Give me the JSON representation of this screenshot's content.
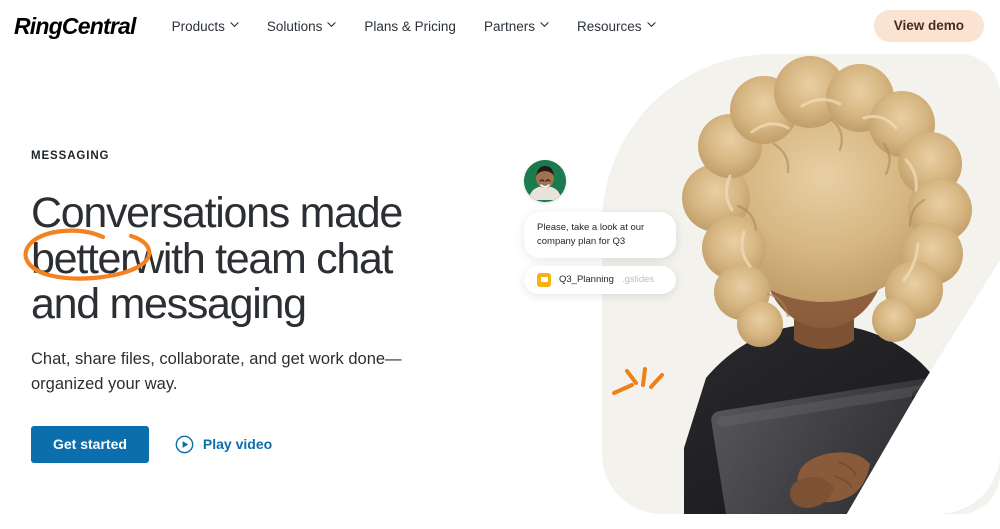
{
  "header": {
    "logo": {
      "part1": "Ring",
      "part2": "Central",
      "color1": "#0684bc",
      "color2": "#f68b1f"
    },
    "nav": [
      {
        "label": "Products",
        "has_dropdown": true,
        "icon": "chevron-down-icon"
      },
      {
        "label": "Solutions",
        "has_dropdown": true,
        "icon": "chevron-down-icon"
      },
      {
        "label": "Plans & Pricing",
        "has_dropdown": false
      },
      {
        "label": "Partners",
        "has_dropdown": true,
        "icon": "chevron-down-icon"
      },
      {
        "label": "Resources",
        "has_dropdown": true,
        "icon": "chevron-down-icon"
      }
    ],
    "cta": {
      "label": "View demo",
      "bg": "#fbe3d2",
      "color": "#4a2a1a"
    }
  },
  "hero": {
    "eyebrow": "MESSAGING",
    "headline": {
      "line1": "Conversations made",
      "line2_circled": "better",
      "line2_rest": "with team chat",
      "line3": "and messaging",
      "circle_color": "#f58220"
    },
    "subhead": {
      "line1": "Chat, share files, collaborate, and get work done—",
      "line2": "organized your way."
    },
    "primary_cta": {
      "label": "Get started",
      "bg": "#0b6fae",
      "color": "#ffffff"
    },
    "secondary_cta": {
      "label": "Play video",
      "icon": "play-circle-icon",
      "color": "#0b6fae"
    }
  },
  "chat_overlay": {
    "avatar": {
      "name": "avatar",
      "bg": "#1c7a4f"
    },
    "message": "Please, take a look at our company plan for Q3",
    "attachment": {
      "name": "Q3_Planning",
      "extension": ".gslides",
      "icon": "slides-file-icon",
      "icon_color": "#f5b314"
    }
  },
  "artwork": {
    "blob_color": "#f4f2ed",
    "sparkle_color": "#f07f1a",
    "description": "smiling woman with curly blonde hair holding a tablet"
  }
}
